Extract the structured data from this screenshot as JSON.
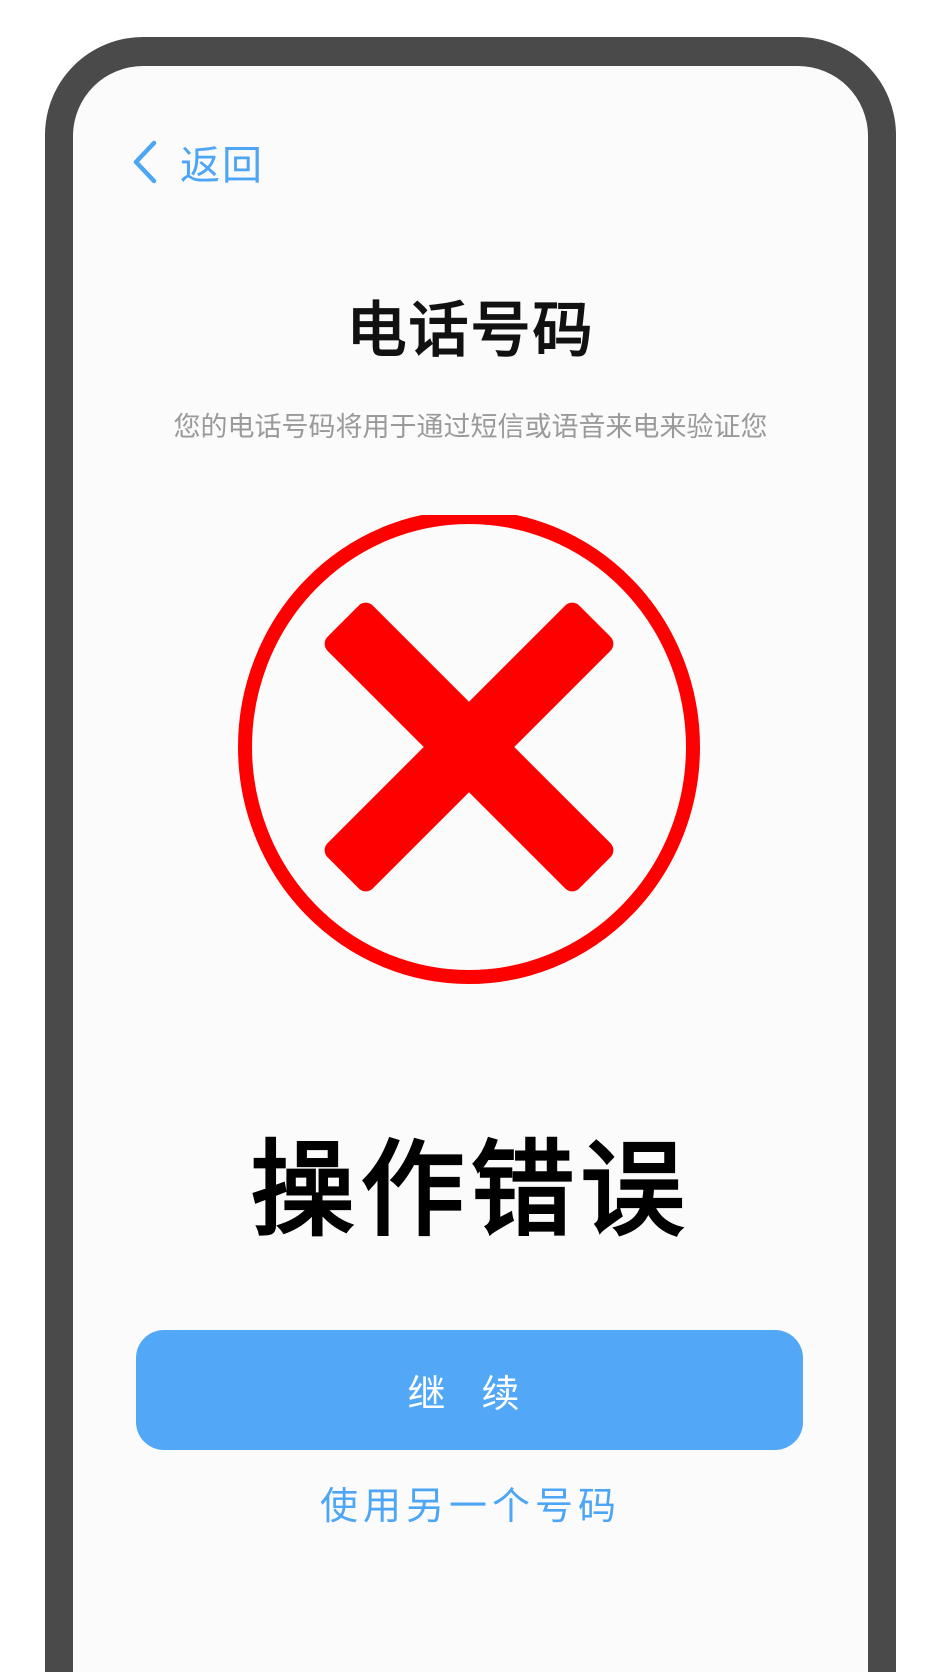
{
  "nav": {
    "back_label": "返回",
    "back_icon": "chevron-left-icon"
  },
  "header": {
    "title": "电话号码",
    "subtitle": "您的电话号码将用于通过短信或语音来电来验证您"
  },
  "error": {
    "icon": "error-x-icon",
    "message": "操作错误"
  },
  "actions": {
    "continue_label": "继 续",
    "alt_number_label": "使用另一个号码"
  },
  "colors": {
    "accent": "#4da6f5",
    "button": "#52a8f6",
    "error_red": "#ff0000",
    "frame": "#4a4a4a"
  }
}
